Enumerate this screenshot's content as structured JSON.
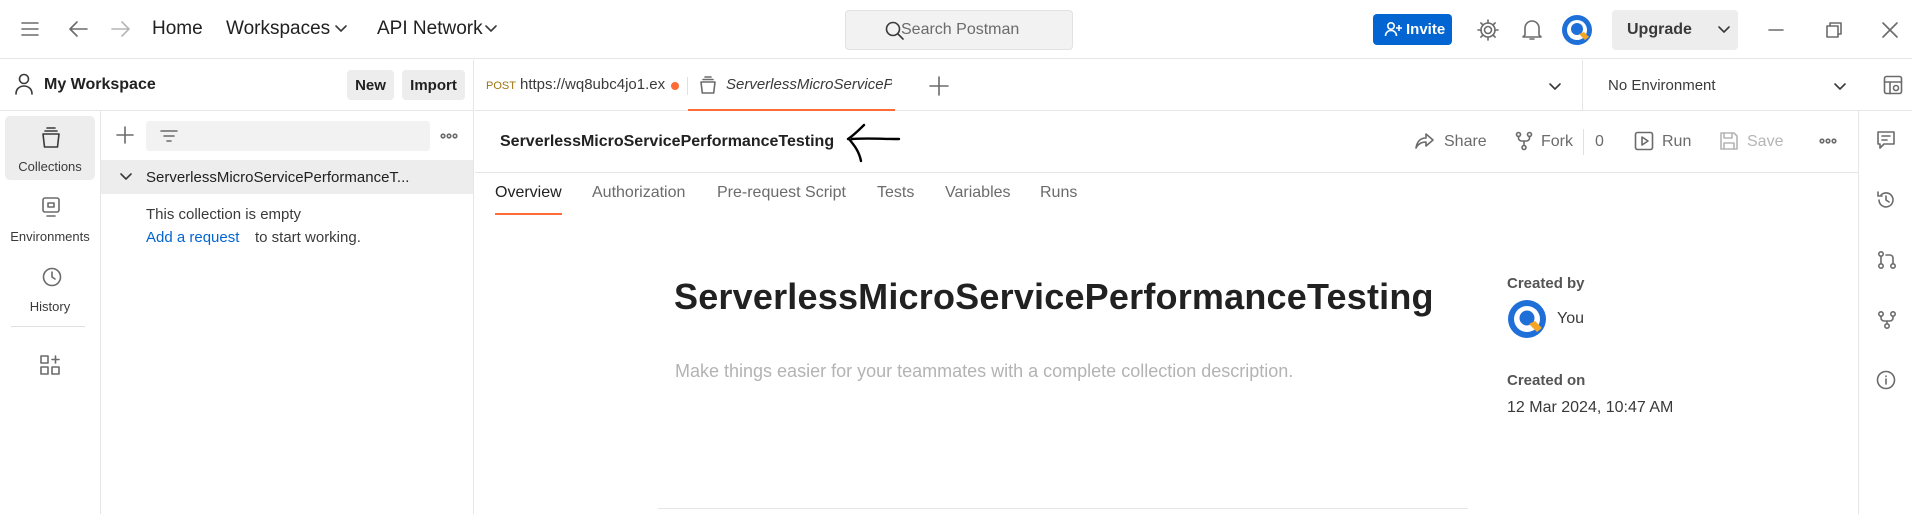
{
  "topbar": {
    "home": "Home",
    "workspaces": "Workspaces",
    "api_network": "API Network",
    "search_placeholder": "Search Postman",
    "invite": "Invite",
    "upgrade": "Upgrade"
  },
  "sidebar": {
    "workspace_name": "My Workspace",
    "new_label": "New",
    "import_label": "Import",
    "rail": [
      {
        "label": "Collections",
        "icon": "collections-icon",
        "active": true
      },
      {
        "label": "Environments",
        "icon": "environments-icon"
      },
      {
        "label": "History",
        "icon": "history-icon"
      }
    ],
    "collection_name": "ServerlessMicroServicePerformanceT...",
    "empty_text": "This collection is empty",
    "add_request_link": "Add a request",
    "add_request_suffix": "to start working."
  },
  "tabs": [
    {
      "method": "POST",
      "label": "https://wq8ubc4jo1.ex"
    },
    {
      "label": "ServerlessMicroServicePe",
      "active": true
    }
  ],
  "environment": "No Environment",
  "collection": {
    "header_name": "ServerlessMicroServicePerformanceTesting",
    "share": "Share",
    "fork": "Fork",
    "fork_count": "0",
    "run": "Run",
    "save": "Save",
    "subtabs": [
      "Overview",
      "Authorization",
      "Pre-request Script",
      "Tests",
      "Variables",
      "Runs"
    ],
    "title": "ServerlessMicroServicePerformanceTesting",
    "description_placeholder": "Make things easier for your teammates with a complete collection description.",
    "created_by_label": "Created by",
    "created_by": "You",
    "created_on_label": "Created on",
    "created_on": "12 Mar 2024, 10:47 AM"
  },
  "colors": {
    "accent": "#ff6c37",
    "invite": "#0265d2",
    "link": "#0265d2"
  }
}
